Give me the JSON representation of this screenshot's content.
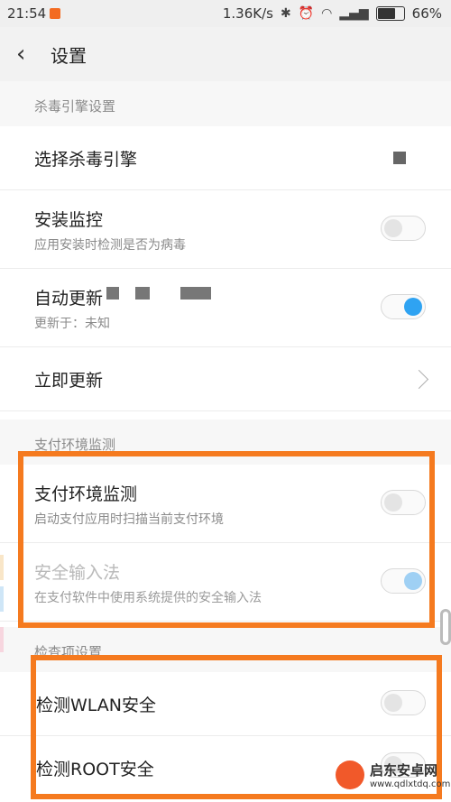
{
  "status_bar": {
    "time": "21:54",
    "network_speed": "1.36K/s",
    "battery_percent": "66%"
  },
  "header": {
    "title": "设置"
  },
  "sections": {
    "engine": {
      "header": "杀毒引擎设置",
      "choose_engine": {
        "label": "选择杀毒引擎"
      },
      "install_monitor": {
        "label": "安装监控",
        "sub": "应用安装时检测是否为病毒",
        "enabled": false
      },
      "auto_update": {
        "label": "自动更新",
        "sub": "更新于：未知",
        "enabled": true
      },
      "update_now": {
        "label": "立即更新"
      }
    },
    "payment": {
      "header": "支付环境监测",
      "payment_monitor": {
        "label": "支付环境监测",
        "sub": "启动支付应用时扫描当前支付环境",
        "enabled": false
      },
      "secure_input": {
        "label": "安全输入法",
        "sub": "在支付软件中使用系统提供的安全输入法",
        "enabled": true
      }
    },
    "checks": {
      "header": "检查项设置",
      "wlan_check": {
        "label": "检测WLAN安全",
        "enabled": false
      },
      "root_check": {
        "label": "检测ROOT安全",
        "enabled": false
      }
    }
  },
  "watermark": {
    "brand": "启东安卓网",
    "url": "www.qdlxtdq.com"
  },
  "colors": {
    "accent": "#2fa3f2",
    "highlight": "#f57a1f"
  },
  "icons": [
    "back-arrow-icon",
    "chevron-right-icon",
    "bluetooth-icon",
    "wifi-icon",
    "signal-icon",
    "battery-icon"
  ]
}
